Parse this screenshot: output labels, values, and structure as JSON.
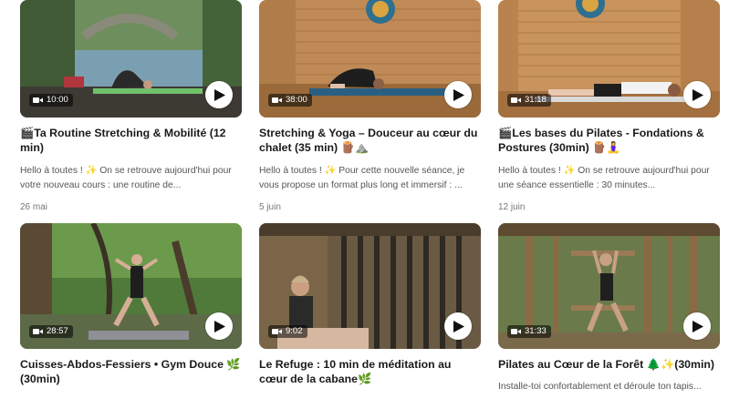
{
  "colors": {
    "page_background": "#ffffff",
    "title_text": "#1a1a1a",
    "description_text": "#555555",
    "date_text": "#777777",
    "duration_badge": "rgba(0,0,0,0.55)",
    "play_button": "#ffffff"
  },
  "videos": [
    {
      "duration": "10:00",
      "title": "🎬Ta Routine Stretching & Mobilité (12 min)",
      "description": "Hello à toutes ! ✨ On se retrouve aujourd'hui pour votre nouveau cours : une routine de...",
      "date": "26 mai"
    },
    {
      "duration": "38:00",
      "title": "Stretching & Yoga – Douceur au cœur du chalet (35 min) 🪵⛰️",
      "description": "Hello à toutes ! ✨ Pour cette nouvelle séance, je vous propose un format plus long et immersif : ...",
      "date": "5 juin"
    },
    {
      "duration": "31:18",
      "title": "🎬Les bases du Pilates - Fondations & Postures (30min) 🪵🧘‍♀️",
      "description": "Hello à toutes ! ✨ On se retrouve aujourd'hui pour une séance essentielle : 30 minutes...",
      "date": "12 juin"
    },
    {
      "duration": "28:57",
      "title": "Cuisses-Abdos-Fessiers • Gym Douce 🌿 (30min)",
      "description": "",
      "date": ""
    },
    {
      "duration": "9:02",
      "title": "Le Refuge : 10 min de méditation au cœur de la cabane🌿",
      "description": "",
      "date": ""
    },
    {
      "duration": "31:33",
      "title": "Pilates au Cœur de la Forêt 🌲✨(30min)",
      "description": "Installe-toi confortablement et déroule ton tapis...",
      "date": ""
    }
  ]
}
